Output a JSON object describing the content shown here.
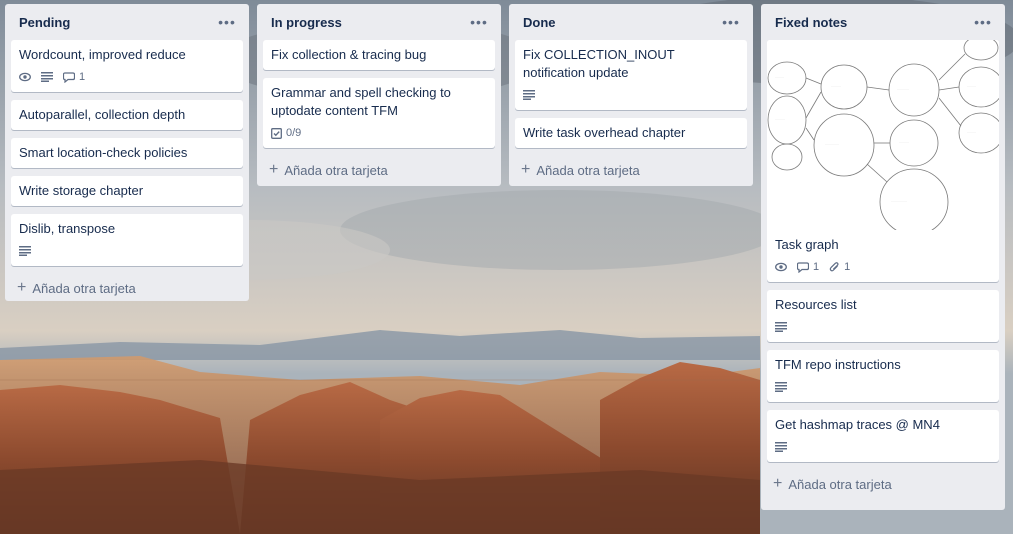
{
  "lists": [
    {
      "title": "Pending",
      "add_label": "Añada otra tarjeta",
      "cards": [
        {
          "title": "Wordcount, improved reduce",
          "comments": "1"
        },
        {
          "title": "Autoparallel, collection depth"
        },
        {
          "title": "Smart location-check policies"
        },
        {
          "title": "Write storage chapter"
        },
        {
          "title": "Dislib, transpose"
        }
      ]
    },
    {
      "title": "In progress",
      "add_label": "Añada otra tarjeta",
      "cards": [
        {
          "title": "Fix collection & tracing bug"
        },
        {
          "title": "Grammar and spell checking to uptodate content TFM",
          "checklist": "0/9"
        }
      ]
    },
    {
      "title": "Done",
      "add_label": "Añada otra tarjeta",
      "cards": [
        {
          "title": "Fix COLLECTION_INOUT notification update"
        },
        {
          "title": "Write task overhead chapter"
        }
      ]
    },
    {
      "title": "Fixed notes",
      "add_label": "Añada otra tarjeta",
      "cards": [
        {
          "title": "Task graph",
          "comments": "1",
          "attachments": "1"
        },
        {
          "title": "Resources list"
        },
        {
          "title": "TFM repo instructions"
        },
        {
          "title": "Get hashmap traces @ MN4"
        }
      ]
    }
  ],
  "icons": {
    "menu": "ellipsis-icon",
    "watch": "eye-icon",
    "description": "description-icon",
    "comment": "comment-icon",
    "checklist": "checklist-icon",
    "attachment": "paperclip-icon",
    "add": "plus-icon"
  },
  "colors": {
    "list_bg": "#ebecf0",
    "card_bg": "#ffffff",
    "text": "#172b4d",
    "muted": "#5e6c84"
  }
}
